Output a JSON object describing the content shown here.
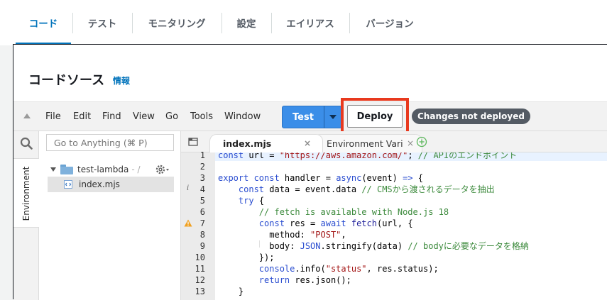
{
  "top_tabs": [
    {
      "label": "コード"
    },
    {
      "label": "テスト"
    },
    {
      "label": "モニタリング"
    },
    {
      "label": "設定"
    },
    {
      "label": "エイリアス"
    },
    {
      "label": "バージョン"
    }
  ],
  "panel": {
    "title": "コードソース",
    "info_link": "情報"
  },
  "menubar": {
    "items": [
      "File",
      "Edit",
      "Find",
      "View",
      "Go",
      "Tools",
      "Window"
    ],
    "test_label": "Test",
    "deploy_label": "Deploy",
    "status_badge": "Changes not deployed"
  },
  "sidebar": {
    "env_tab": "Environment",
    "goto_placeholder": "Go to Anything (⌘ P)",
    "folder_name": "test-lambda",
    "folder_suffix": "- /",
    "file_name": "index.mjs"
  },
  "editor": {
    "tabs": [
      {
        "label": "index.mjs"
      },
      {
        "label": "Environment Vari"
      }
    ],
    "close_glyph": "×",
    "lines": [
      {
        "num": "1",
        "html": "<span class='kw'>const</span> url = <span class='str'>\"https://aws.amazon.com/\"</span>; <span class='cm'>// APIのエンドポイント</span>"
      },
      {
        "num": "2",
        "html": ""
      },
      {
        "num": "3",
        "html": "<span class='kw'>export const</span> handler = <span class='kw'>async</span>(event) <span class='kw'>=&gt;</span> {"
      },
      {
        "num": "4",
        "html": "    <span class='kw'>const</span> data = event.data <span class='cm'>// CMSから渡されるデータを抽出</span>"
      },
      {
        "num": "5",
        "html": "    <span class='kw'>try</span> {"
      },
      {
        "num": "6",
        "html": "        <span class='cm'>// fetch is available with Node.js 18</span>"
      },
      {
        "num": "7",
        "html": "        <span class='kw'>const</span> res = <span class='kw'>await</span> <span class='fn'>fetch</span>(url, {"
      },
      {
        "num": "8",
        "html": "          method: <span class='str'>\"POST\"</span>,"
      },
      {
        "num": "9",
        "html": "          body: <span class='kw'>JSON</span>.stringify(data) <span class='cm'>// bodyに必要なデータを格納</span>"
      },
      {
        "num": "10",
        "html": "        });"
      },
      {
        "num": "11",
        "html": "        <span class='kw'>console</span>.info(<span class='str'>\"status\"</span>, res.status);"
      },
      {
        "num": "12",
        "html": "        <span class='kw'>return</span> res.json();"
      },
      {
        "num": "13",
        "html": "    }"
      }
    ],
    "gutter_info": "i"
  },
  "colors": {
    "accent": "#0073bb",
    "test_button": "#3b8ee8",
    "deploy_highlight": "#e8391e",
    "badge": "#545b64"
  }
}
